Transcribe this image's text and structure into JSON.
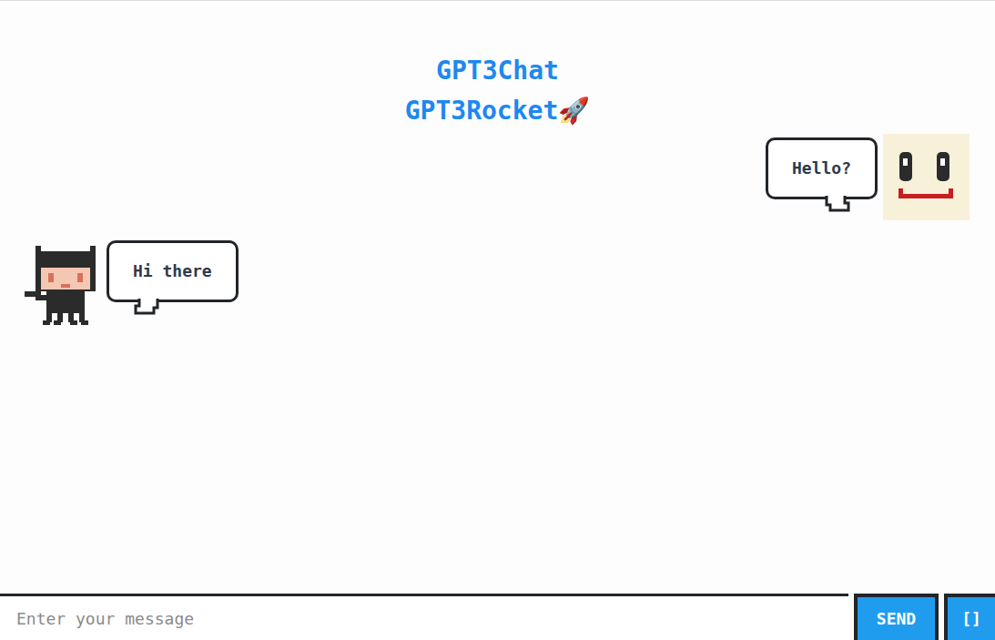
{
  "header": {
    "title": "GPT3Chat",
    "subtitle": "GPT3Rocket🚀"
  },
  "messages": [
    {
      "kind": "user",
      "text": "Hello?"
    },
    {
      "kind": "bot",
      "text": "Hi there"
    }
  ],
  "input": {
    "placeholder": "Enter your message"
  },
  "buttons": {
    "send": "SEND",
    "extra": "[]"
  }
}
